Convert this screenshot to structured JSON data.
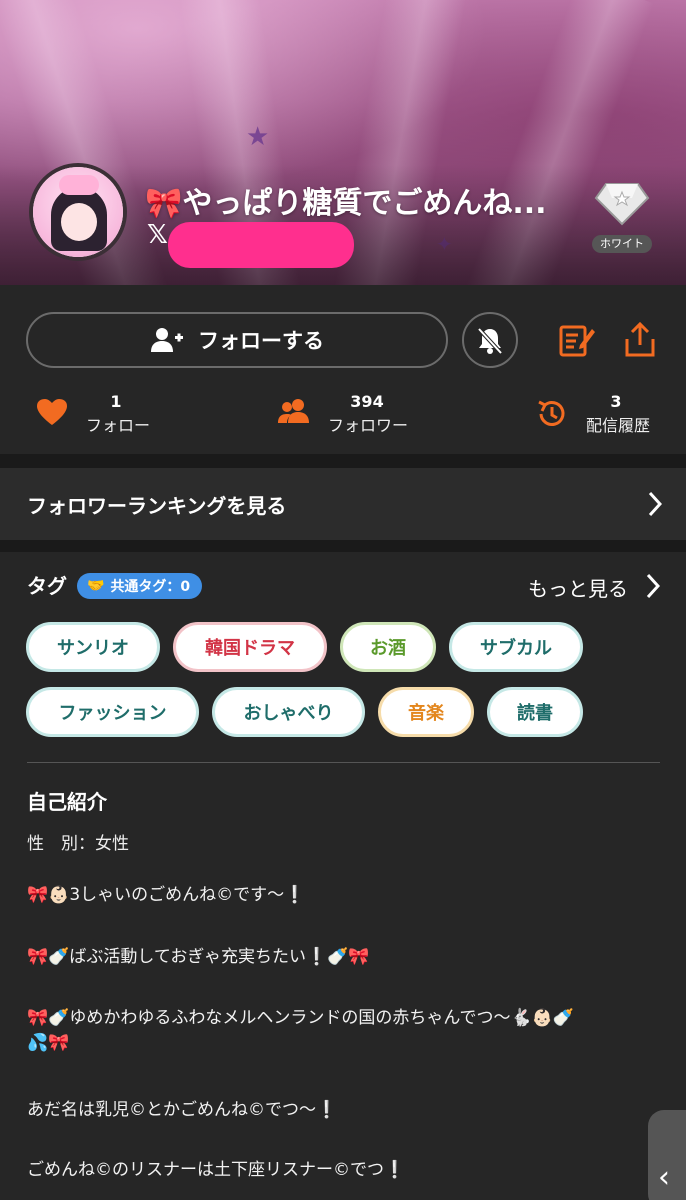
{
  "header": {
    "title": "🎀やっぱり糖質でごめんね...",
    "x_icon": "x-logo-icon",
    "rank_badge": "ホワイト"
  },
  "actions": {
    "follow_label": "フォローする",
    "follow_icon": "person-add-icon",
    "notify_icon": "bell-off-icon",
    "edit_icon": "edit-note-icon",
    "share_icon": "share-icon"
  },
  "stats": [
    {
      "value": "1",
      "label": "フォロー",
      "icon": "heart-icon"
    },
    {
      "value": "394",
      "label": "フォロワー",
      "icon": "people-icon"
    },
    {
      "value": "3",
      "label": "配信履歴",
      "icon": "history-icon"
    }
  ],
  "ranking": {
    "label": "フォロワーランキングを見る"
  },
  "tags": {
    "title": "タグ",
    "common": "共通タグ：0",
    "more": "もっと見る",
    "items": [
      "サンリオ",
      "韓国ドラマ",
      "お酒",
      "サブカル",
      "ファッション",
      "おしゃべり",
      "音楽",
      "読書"
    ]
  },
  "profile": {
    "title": "自己紹介",
    "gender": "性　別：女性",
    "bio": [
      "🎀👶🏻3しゃいのごめんね©です〜❕",
      "🎀🍼ばぶ活動しておぎゃ充実ちたい❕🍼🎀",
      "🎀🍼ゆめかわゆるふわなメルヘンランドの国の赤ちゃんでつ〜🐇👶🏻🍼",
      "💦🎀",
      "あだ名は乳児©とかごめんね©でつ〜❕",
      "ごめんね©のリスナーは土下座リスナー©でつ❕"
    ]
  },
  "colors": {
    "accent": "#f26b21",
    "background": "#262626",
    "common_tag": "#3f8fe5",
    "redaction": "#ff2f8e"
  }
}
